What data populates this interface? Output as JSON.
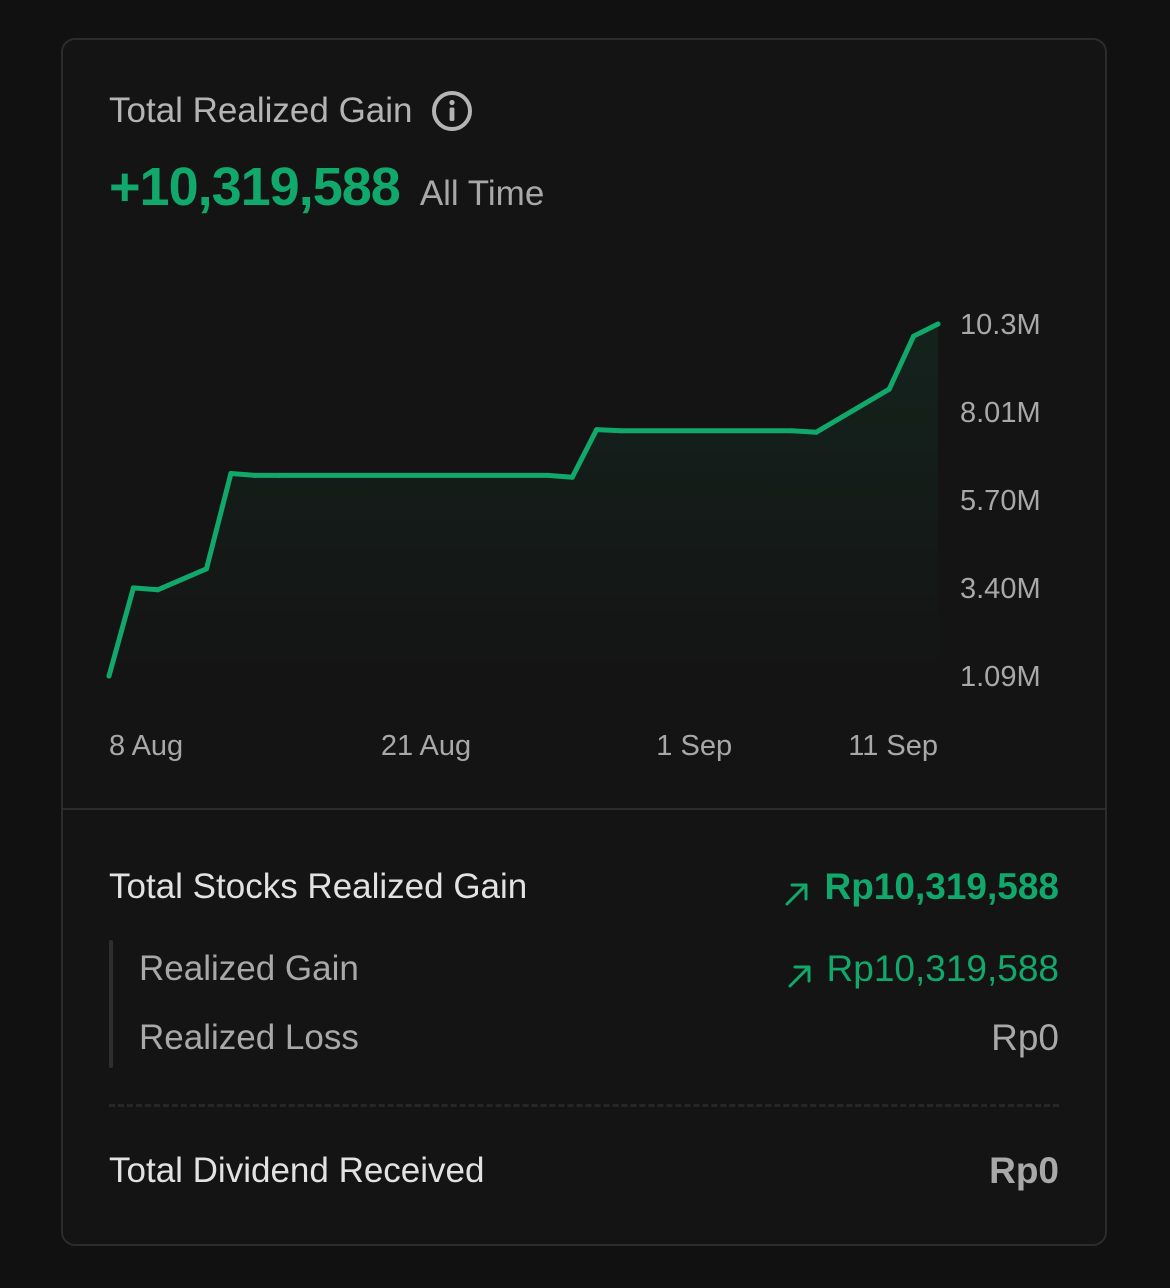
{
  "header": {
    "title": "Total Realized Gain",
    "info_icon": "info-icon",
    "value": "+10,319,588",
    "period": "All Time"
  },
  "colors": {
    "accent": "#11a86b",
    "background": "#111111",
    "card": "#141414",
    "border": "#2c2c2c",
    "muted_text": "#a8a8a8"
  },
  "chart_data": {
    "type": "area",
    "x": [
      "8 Aug",
      "9 Aug",
      "10 Aug",
      "12 Aug",
      "13 Aug",
      "14 Aug",
      "15 Aug",
      "26 Aug",
      "27 Aug",
      "28 Aug",
      "29 Aug",
      "5 Sep",
      "6 Sep",
      "9 Sep",
      "10 Sep",
      "11 Sep"
    ],
    "series": [
      {
        "values": [
          1.09,
          3.4,
          3.35,
          3.9,
          6.4,
          6.35,
          6.35,
          6.35,
          6.3,
          7.55,
          7.52,
          7.52,
          7.48,
          8.61,
          10.0,
          10.32
        ]
      }
    ],
    "x_ticks": [
      "8 Aug",
      "21 Aug",
      "1 Sep",
      "11 Sep"
    ],
    "y_ticks": [
      "10.3M",
      "8.01M",
      "5.70M",
      "3.40M",
      "1.09M"
    ],
    "y_tick_values": [
      10.32,
      8.01,
      5.7,
      3.4,
      1.09
    ],
    "ylim": [
      1.09,
      10.32
    ],
    "ylabel_position": "right",
    "grid": false,
    "line_color": "#11a86b"
  },
  "breakdown": {
    "total_stocks": {
      "label": "Total Stocks Realized Gain",
      "value": "Rp10,319,588",
      "icon": "arrow-up-right-icon"
    },
    "realized_gain": {
      "label": "Realized Gain",
      "value": "Rp10,319,588",
      "icon": "arrow-up-right-icon"
    },
    "realized_loss": {
      "label": "Realized Loss",
      "value": "Rp0"
    },
    "dividend": {
      "label": "Total Dividend Received",
      "value": "Rp0"
    }
  }
}
